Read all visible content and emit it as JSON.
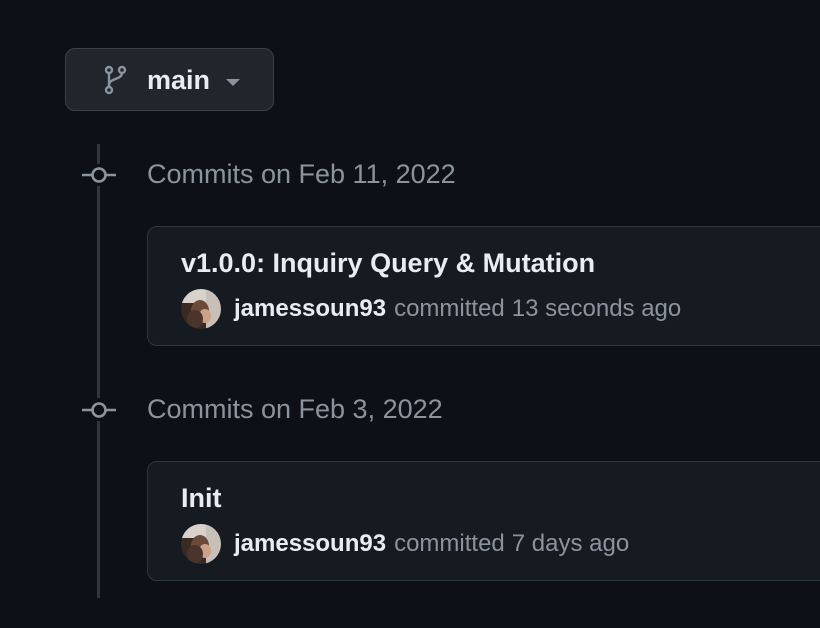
{
  "branch": {
    "icon": "git-branch-icon",
    "name": "main",
    "caret_icon": "triangle-down-icon"
  },
  "groups": [
    {
      "title": "Commits on Feb 11, 2022",
      "commits": [
        {
          "message": "v1.0.0: Inquiry Query & Mutation",
          "author": "jamessoun93",
          "action": "committed",
          "time": "13 seconds ago"
        }
      ]
    },
    {
      "title": "Commits on Feb 3, 2022",
      "commits": [
        {
          "message": "Init",
          "author": "jamessoun93",
          "action": "committed",
          "time": "7 days ago"
        }
      ]
    }
  ],
  "colors": {
    "background": "#0d1117",
    "card": "#161b22",
    "border": "#30363d",
    "text_primary": "#e6edf3",
    "text_muted": "#8b949e"
  }
}
